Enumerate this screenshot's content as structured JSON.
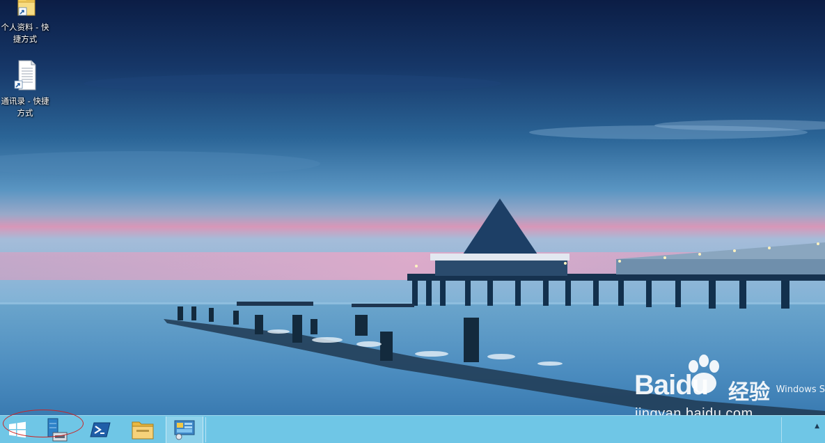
{
  "desktop": {
    "icons": [
      {
        "label": "个人资料 - 快捷方式",
        "icon": "folder-shortcut-icon"
      },
      {
        "label": "通讯录 - 快捷方式",
        "icon": "text-file-shortcut-icon"
      }
    ],
    "os_watermark": "Windows S"
  },
  "taskbar": {
    "background": "#6fc6e6",
    "items": [
      {
        "name": "start",
        "icon": "windows-logo-icon"
      },
      {
        "name": "server-manager",
        "icon": "server-manager-icon"
      },
      {
        "name": "powershell",
        "icon": "powershell-icon"
      },
      {
        "name": "file-explorer",
        "icon": "file-explorer-icon"
      },
      {
        "name": "control-panel",
        "icon": "control-panel-icon",
        "active": true
      }
    ],
    "tray": {
      "icon": "show-hidden-icons-arrow"
    }
  },
  "annotation": {
    "color": "#cc2222",
    "shape": "ellipse"
  },
  "watermark": {
    "brand": "Baidu",
    "brand_cn": "经验",
    "url": "jingyan.baidu.com"
  }
}
